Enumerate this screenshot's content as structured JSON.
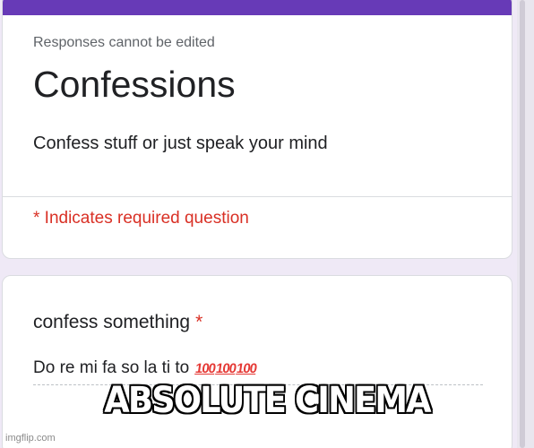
{
  "form": {
    "notice": "Responses cannot be edited",
    "title": "Confessions",
    "description": "Confess stuff or just speak your mind",
    "required_note": "* Indicates required question"
  },
  "question": {
    "label": "confess something",
    "required_mark": "*",
    "answer": "Do re mi fa so la ti to",
    "emoji": [
      "100",
      "100",
      "100"
    ]
  },
  "caption": "ABSOLUTE CINEMA",
  "watermark": "imgflip.com",
  "colors": {
    "accent": "#673ab7",
    "background": "#efe9f6",
    "required": "#d93025",
    "emoji": "#e53935"
  },
  "icons": [
    "hundred-points-emoji"
  ]
}
